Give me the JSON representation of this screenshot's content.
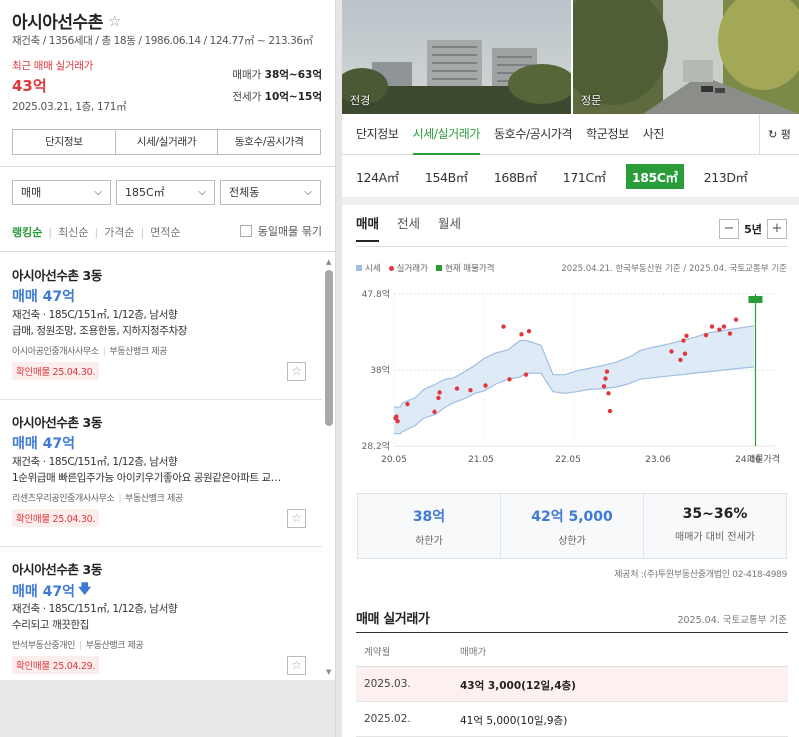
{
  "complex": {
    "name": "아시아선수촌",
    "meta": "재건축 / 1356세대 / 총 18동 / 1986.06.14 / 124.77㎡ ~ 213.36㎡",
    "recent_label": "최근 매매 실거래가",
    "recent_price": "43억",
    "recent_date": "2025.03.21, 1층, 171㎡",
    "sale_label": "매매가",
    "sale_range": "38억~63억",
    "jeonse_label": "전세가",
    "jeonse_range": "10억~15억"
  },
  "left_tabs": [
    "단지정보",
    "시세/실거래가",
    "동호수/공시가격"
  ],
  "filters": {
    "trade_type": "매매",
    "area": "185C㎡",
    "dong": "전체동",
    "sorts": [
      "랭킹순",
      "최신순",
      "가격순",
      "면적순"
    ],
    "group_label": "동일매물 묶기"
  },
  "listings": [
    {
      "name": "아시아선수촌 3동",
      "price": "매매 47억",
      "price_down": false,
      "spec": "재건축 · 185C/151㎡, 1/12층, 남서향",
      "desc": "급매, 정원조망, 조용한동, 지하지정주차장",
      "agent": "아시아공인중개사사무소",
      "provider": "부동산뱅크 제공",
      "confirmed": "확인매물 25.04.30."
    },
    {
      "name": "아시아선수촌 3동",
      "price": "매매 47억",
      "price_down": false,
      "spec": "재건축 · 185C/151㎡, 1/12층, 남서향",
      "desc": "1순위급매 빠른입주가능 아이키우기좋아요 공원같은아파트 교…",
      "agent": "리센츠우리공인중개사사무소",
      "provider": "부동산뱅크 제공",
      "confirmed": "확인매물 25.04.30."
    },
    {
      "name": "아시아선수촌 3동",
      "price": "매매 47억",
      "price_down": true,
      "spec": "재건축 · 185C/151㎡, 1/12층, 남서향",
      "desc": "수리되고 깨끗한집",
      "agent": "반석부동산중개인",
      "provider": "부동산뱅크 제공",
      "confirmed": "확인매물 25.04.29."
    }
  ],
  "photos": [
    "전경",
    "정문"
  ],
  "right_tabs": [
    "단지정보",
    "시세/실거래가",
    "동호수/공시가격",
    "학군정보",
    "사진"
  ],
  "refresh_label": "평",
  "areas": [
    "124A㎡",
    "154B㎡",
    "168B㎡",
    "171C㎡",
    "185C㎡",
    "213D㎡"
  ],
  "area_selected": 4,
  "deal_tabs": [
    "매매",
    "전세",
    "월세"
  ],
  "period": "5년",
  "legend": [
    "시세",
    "실거래가",
    "현재 매물가격"
  ],
  "basis": "2025.04.21. 한국부동산원 기준 / 2025.04. 국토교통부 기준",
  "colors": {
    "accent": "#2a9d3a",
    "price_blue": "#3d7ad6",
    "deal_red": "#e0373d",
    "band": "#dbe8f6",
    "line": "#9fbfe3"
  },
  "chart_data": {
    "type": "line",
    "x_ticks": [
      "20.05",
      "21.05",
      "22.05",
      "23.06",
      "24.06",
      "매물가격"
    ],
    "y_ticks": [
      "47.8억",
      "38억",
      "28.2억"
    ],
    "ylim": [
      28.2,
      47.8
    ],
    "series": [
      {
        "name": "시세",
        "kind": "band",
        "x": [
          0.0,
          0.2,
          0.3,
          0.3,
          0.7,
          0.7,
          1.0,
          1.0,
          1.4,
          1.4,
          1.7,
          1.7,
          2.0,
          2.0,
          2.4,
          2.4,
          2.7,
          2.7,
          3.0,
          3.0,
          3.4,
          3.4,
          3.8,
          3.8,
          4.2,
          4.2,
          4.4,
          4.4,
          4.9,
          4.9,
          5.3,
          5.3,
          5.7,
          5.7,
          6.1,
          6.1,
          6.5,
          6.5,
          7.0,
          7.0,
          7.4,
          7.4,
          7.8,
          7.8,
          8.0,
          8.0,
          8.2,
          8.2,
          8.6,
          8.6,
          9.1,
          9.1,
          9.6,
          9.6,
          10.0,
          10.0,
          10.5,
          10.5,
          11.0,
          11.0,
          11.5,
          11.5,
          12.0
        ],
        "high": [
          33.2,
          33.2,
          33.8,
          33.8,
          34.4,
          34.4,
          35.5,
          35.5,
          36.2,
          36.2,
          36.8,
          36.8,
          37.0,
          37.0,
          37.9,
          37.9,
          38.6,
          38.6,
          39.5,
          39.5,
          40.2,
          40.2,
          40.6,
          40.6,
          41.8,
          41.8,
          41.8,
          41.8,
          41.2,
          41.2,
          37.4,
          37.4,
          37.4,
          37.4,
          37.9,
          37.9,
          38.2,
          38.2,
          38.6,
          38.6,
          39.0,
          39.0,
          39.6,
          39.6,
          40.0,
          40.0,
          40.5,
          40.5,
          40.9,
          40.9,
          41.3,
          41.3,
          41.8,
          41.8,
          42.2,
          42.2,
          42.8,
          42.8,
          43.1,
          43.1,
          43.4,
          43.4,
          43.7
        ],
        "low": [
          29.8,
          29.8,
          30.1,
          30.1,
          30.8,
          30.8,
          31.8,
          31.8,
          32.3,
          32.3,
          33.2,
          33.2,
          33.8,
          33.8,
          34.4,
          34.4,
          35.0,
          35.0,
          35.3,
          35.3,
          36.2,
          36.2,
          36.8,
          36.8,
          37.1,
          37.1,
          37.6,
          37.6,
          37.6,
          37.6,
          35.2,
          35.2,
          35.0,
          35.0,
          35.2,
          35.2,
          35.5,
          35.5,
          35.6,
          35.6,
          35.8,
          35.8,
          36.2,
          36.2,
          36.5,
          36.5,
          36.8,
          36.8,
          37.0,
          37.0,
          37.2,
          37.2,
          37.4,
          37.4,
          37.6,
          37.6,
          37.8,
          37.8,
          38.0,
          38.0,
          38.2,
          38.2,
          38.4
        ]
      },
      {
        "name": "실거래가",
        "kind": "points",
        "x": [
          0.05,
          0.08,
          0.12,
          0.45,
          1.35,
          1.48,
          1.52,
          2.1,
          2.55,
          3.05,
          3.65,
          3.85,
          4.25,
          4.4,
          4.5,
          7.0,
          7.05,
          7.1,
          7.15,
          7.2,
          9.25,
          9.55,
          9.65,
          9.7,
          9.75,
          10.4,
          10.6,
          10.85,
          11.0,
          11.2,
          11.4
        ],
        "y": [
          31.8,
          32.0,
          31.4,
          33.6,
          32.6,
          34.4,
          35.1,
          35.6,
          35.4,
          36.0,
          43.6,
          36.8,
          42.6,
          37.4,
          43.0,
          35.9,
          36.9,
          37.8,
          35.0,
          32.7,
          40.4,
          39.3,
          41.8,
          40.1,
          42.4,
          42.5,
          43.6,
          43.2,
          43.6,
          42.7,
          44.5
        ]
      },
      {
        "name": "현재 매물가격",
        "kind": "range",
        "x": 12.05,
        "low": 28.2,
        "high": 47.8
      }
    ],
    "xlim": [
      0,
      12.7
    ],
    "grid": true
  },
  "stats": [
    {
      "value": "38억",
      "label": "하한가"
    },
    {
      "value": "42억 5,000",
      "label": "상한가"
    },
    {
      "value": "35~36%",
      "label": "매매가 대비 전세가"
    }
  ],
  "source": "제공처 :(주)투윈부동산중개법인 02-418-4989",
  "deals": {
    "title": "매매 실거래가",
    "basis": "2025.04. 국토교통부 기준",
    "header": [
      "계약월",
      "매매가"
    ],
    "rows": [
      {
        "month": "2025.03.",
        "price": "43억 3,000(12일,4층)"
      },
      {
        "month": "2025.02.",
        "price": "41억 5,000(10일,9층)"
      }
    ]
  }
}
